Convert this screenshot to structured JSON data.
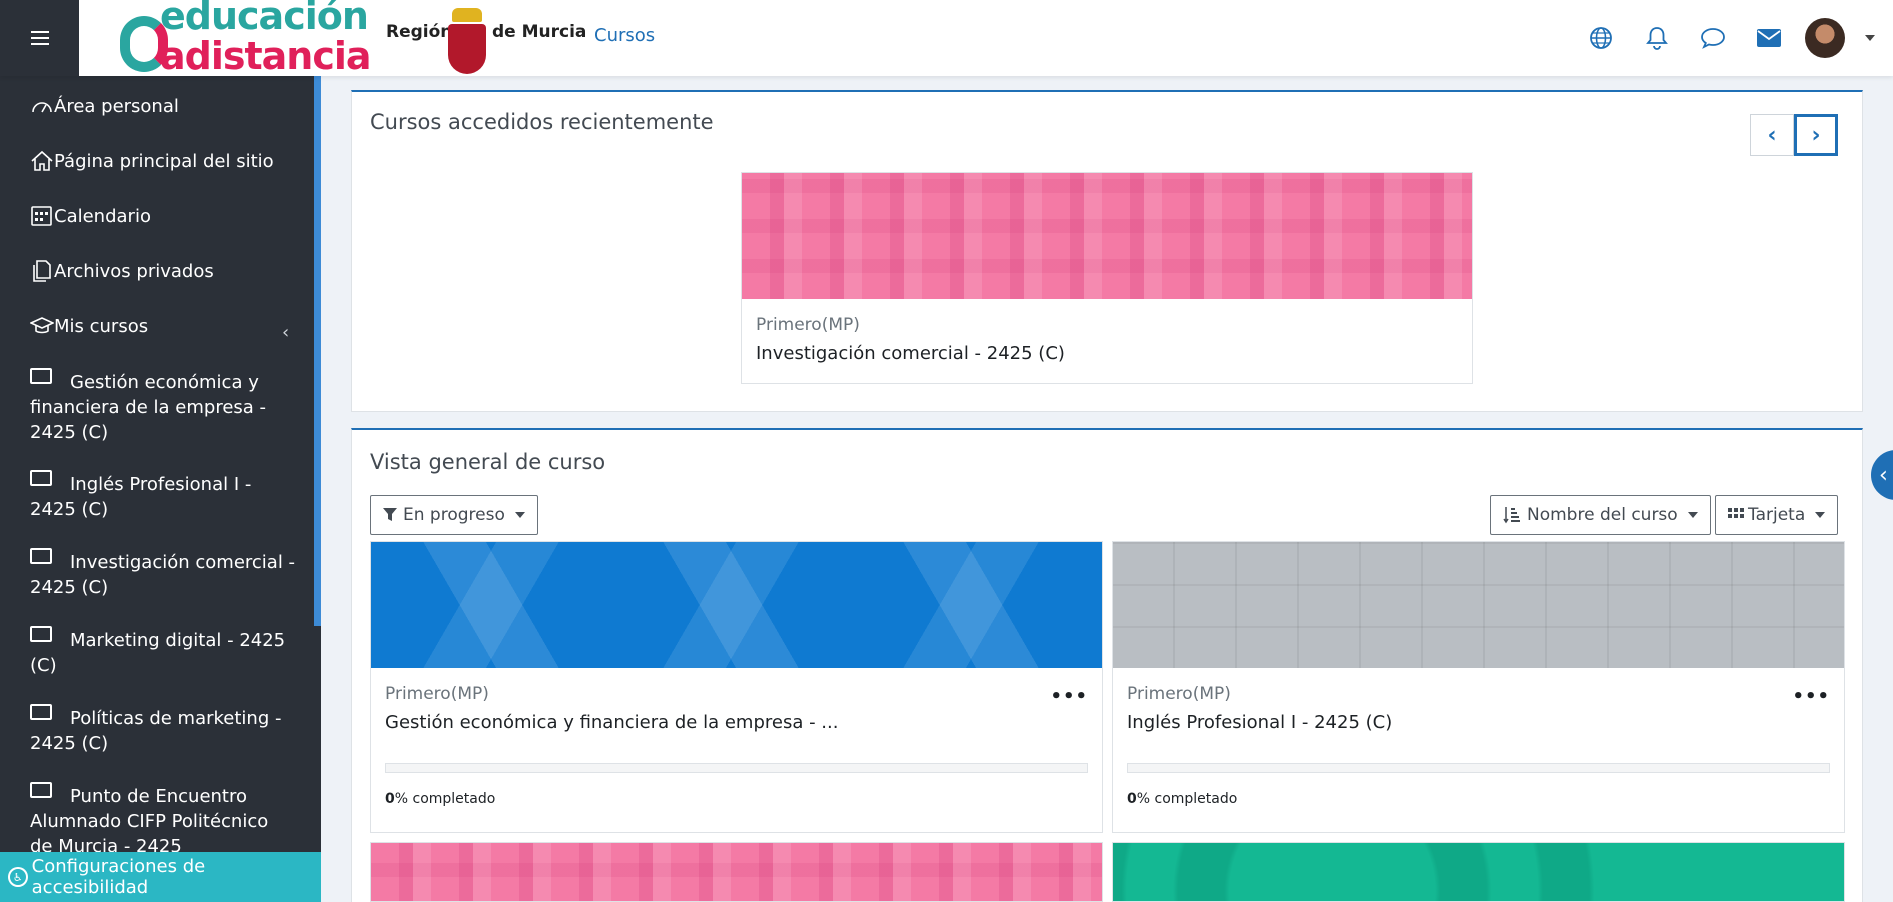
{
  "navbar": {
    "brand_line1": "educación",
    "brand_line2": "adistancia",
    "region_left": "Región",
    "region_right": "de Murcia",
    "link_cursos": "Cursos"
  },
  "sidebar": {
    "items": [
      {
        "label": "Área personal",
        "icon": "dashboard-icon"
      },
      {
        "label": "Página principal del sitio",
        "icon": "home-icon"
      },
      {
        "label": "Calendario",
        "icon": "calendar-icon"
      },
      {
        "label": "Archivos privados",
        "icon": "files-icon"
      },
      {
        "label": "Mis cursos",
        "icon": "graduation-cap-icon"
      }
    ],
    "courses": [
      {
        "label": "Gestión económica y financiera de la empresa - 2425 (C)"
      },
      {
        "label": "Inglés Profesional I - 2425 (C)"
      },
      {
        "label": "Investigación comercial - 2425 (C)"
      },
      {
        "label": "Marketing digital - 2425 (C)"
      },
      {
        "label": "Políticas de marketing - 2425 (C)"
      },
      {
        "label": "Punto de Encuentro Alumnado CIFP Politécnico de Murcia - 2425"
      }
    ],
    "accessibility": "Configuraciones de accesibilidad"
  },
  "recent": {
    "title": "Cursos accedidos recientemente",
    "card": {
      "category": "Primero(MP)",
      "name": "Investigación comercial - 2425 (C)"
    }
  },
  "overview": {
    "title": "Vista general de curso",
    "filter": "En progreso",
    "sort": "Nombre del curso",
    "view": "Tarjeta",
    "cards": [
      {
        "category": "Primero(MP)",
        "name": "Gestión económica y financiera de la empresa - ...",
        "progress_value": "0",
        "progress_suffix": "% completado",
        "progress": 0
      },
      {
        "category": "Primero(MP)",
        "name": "Inglés Profesional I - 2425 (C)",
        "progress_value": "0",
        "progress_suffix": "% completado",
        "progress": 0
      }
    ]
  },
  "colors": {
    "accent": "#1f6fb5",
    "sidebar_bg": "#2b3038",
    "access_bg": "#2bb7c4"
  }
}
